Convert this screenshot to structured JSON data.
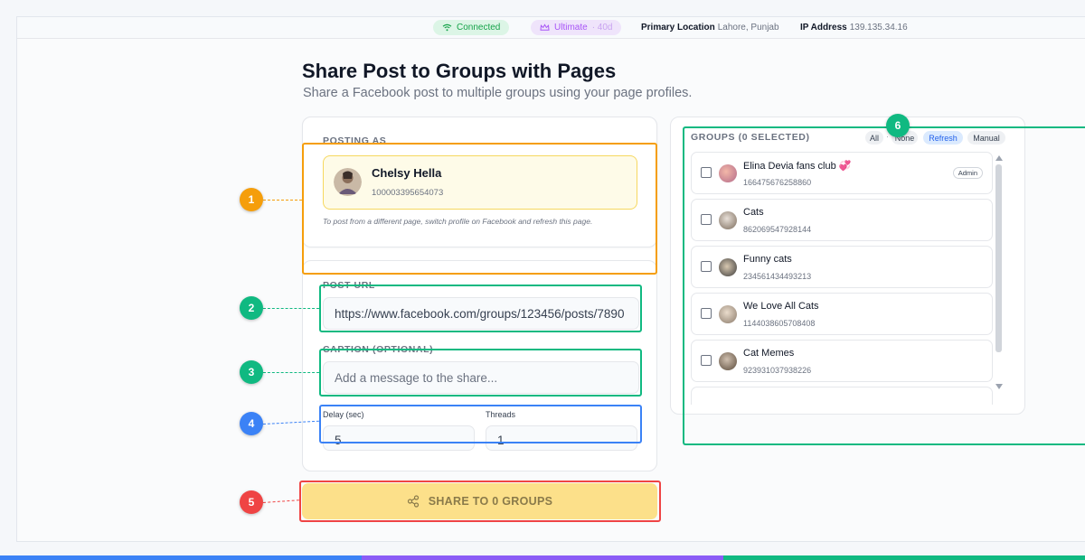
{
  "status": {
    "connected_label": "Connected",
    "plan_label": "Ultimate",
    "plan_days": "· 40d",
    "location_key": "Primary Location",
    "location_value": "Lahore, Punjab",
    "ip_key": "IP Address",
    "ip_value": "139.135.34.16"
  },
  "page": {
    "title": "Share Post to Groups with Pages",
    "subtitle": "Share a Facebook post to multiple groups using your page profiles."
  },
  "posting": {
    "label": "POSTING AS",
    "name": "Chelsy Hella",
    "id": "100003395654073",
    "hint": "To post from a different page, switch profile on Facebook and refresh this page."
  },
  "form": {
    "post_url_label": "POST URL",
    "post_url_value": "https://www.facebook.com/groups/123456/posts/7890",
    "caption_label": "CAPTION (OPTIONAL)",
    "caption_placeholder": "Add a message to the share...",
    "delay_label": "Delay (sec)",
    "delay_value": "5",
    "threads_label": "Threads",
    "threads_value": "1"
  },
  "share_button_label": "SHARE TO 0 GROUPS",
  "groups": {
    "label": "GROUPS (0 SELECTED)",
    "actions": {
      "all": "All",
      "separator": "·",
      "none": "None",
      "refresh": "Refresh",
      "manual": "Manual"
    },
    "admin_label": "Admin",
    "items": [
      {
        "name": "Elina Devia fans club 💞",
        "id": "166475676258860",
        "admin": true
      },
      {
        "name": "Cats",
        "id": "862069547928144",
        "admin": false
      },
      {
        "name": "Funny cats",
        "id": "234561434493213",
        "admin": false
      },
      {
        "name": "We Love All Cats",
        "id": "1144038605708408",
        "admin": false
      },
      {
        "name": "Cat Memes",
        "id": "923931037938226",
        "admin": false
      }
    ]
  },
  "annotations": {
    "n1": "1",
    "n2": "2",
    "n3": "3",
    "n4": "4",
    "n5": "5",
    "n6": "6"
  },
  "colors": {
    "orange": "#f59e0b",
    "green": "#10b981",
    "blue": "#3b82f6",
    "red": "#ef4444",
    "share_button": "#fce08a"
  }
}
